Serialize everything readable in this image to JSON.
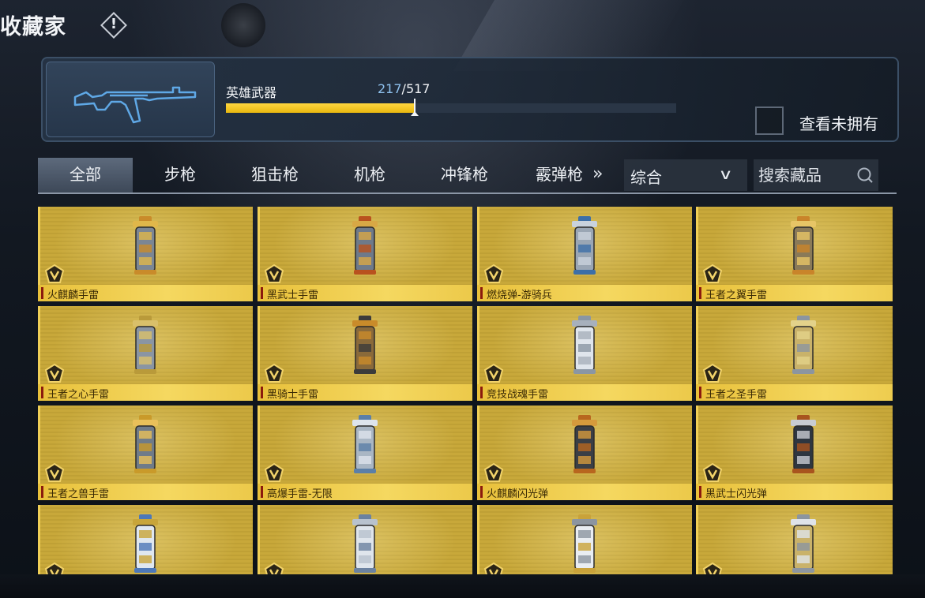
{
  "header": {
    "title": "收藏家",
    "info_icon": "info-diamond-icon",
    "info_mark": "!"
  },
  "progress": {
    "category_label": "英雄武器",
    "owned": "217",
    "separator": "/",
    "total": "517",
    "fraction": 0.42,
    "bar_color": "#f0c419",
    "weapon_icon": "assault-rifle-icon"
  },
  "filter": {
    "show_unowned_label": "查看未拥有",
    "show_unowned_checked": false
  },
  "tabs": [
    {
      "label": "全部",
      "active": true
    },
    {
      "label": "步枪",
      "active": false
    },
    {
      "label": "狙击枪",
      "active": false
    },
    {
      "label": "机枪",
      "active": false
    },
    {
      "label": "冲锋枪",
      "active": false
    },
    {
      "label": "霰弹枪",
      "active": false
    }
  ],
  "more_tabs": "»",
  "sort": {
    "selected": "综合",
    "icon": "chevron-down-icon"
  },
  "search": {
    "placeholder": "搜索藏品",
    "value": "",
    "icon": "search-icon"
  },
  "items": [
    {
      "name": "火麒麟手雷"
    },
    {
      "name": "黑武士手雷"
    },
    {
      "name": "燃烧弹-游骑兵"
    },
    {
      "name": "王者之翼手雷"
    },
    {
      "name": "王者之心手雷"
    },
    {
      "name": "黑骑士手雷"
    },
    {
      "name": "竞技战魂手雷"
    },
    {
      "name": "王者之圣手雷"
    },
    {
      "name": "王者之兽手雷"
    },
    {
      "name": "高爆手雷-无限"
    },
    {
      "name": "火麒麟闪光弹"
    },
    {
      "name": "黑武士闪光弹"
    },
    {
      "name": ""
    },
    {
      "name": ""
    },
    {
      "name": ""
    },
    {
      "name": ""
    }
  ],
  "colors": {
    "card_gold": "#c8a83a",
    "name_bar": "#f5d860",
    "accent": "#8b1a0d",
    "panel_border": "#3b4f66"
  }
}
